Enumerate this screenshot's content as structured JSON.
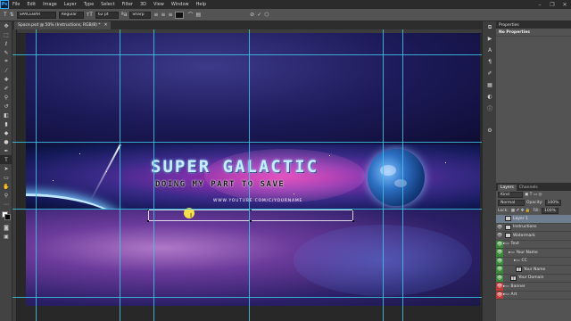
{
  "app": {
    "logo": "Ps"
  },
  "menu": [
    "File",
    "Edit",
    "Image",
    "Layer",
    "Type",
    "Select",
    "Filter",
    "3D",
    "View",
    "Window",
    "Help"
  ],
  "window_controls": {
    "minimize": "–",
    "restore": "❐",
    "close": "✕"
  },
  "options": {
    "font_family": "SPACEBAR",
    "font_style": "Regular",
    "font_size": "62 pt",
    "antialias": "Sharp"
  },
  "document": {
    "tab_title": "Space.psd @ 50% (Instructions, RGB/8) *"
  },
  "banner": {
    "title": "SUPER GALACTIC",
    "subtitle": "DOING MY PART TO SAVE",
    "url": "WWW.YOUTUBE.COM/C/YOURNAME"
  },
  "panels": {
    "properties_tab": "Properties",
    "properties_title": "No Properties",
    "layers_tab": "Layers",
    "channels_tab": "Channels",
    "kind": "Kind",
    "blend_mode": "Normal",
    "opacity_label": "Opacity:",
    "opacity_value": "100%",
    "lock_label": "Lock:",
    "fill_label": "Fill:",
    "fill_value": "100%"
  },
  "layers": [
    {
      "name": "Layer 1",
      "indent": 0,
      "eye": "none",
      "selected": true,
      "kind": "pixel"
    },
    {
      "name": "Instructions",
      "indent": 0,
      "eye": "plain",
      "selected": false,
      "kind": "pixel"
    },
    {
      "name": "Watermark",
      "indent": 0,
      "eye": "plain",
      "selected": false,
      "kind": "pixel"
    },
    {
      "name": "Text",
      "indent": 0,
      "eye": "green",
      "selected": false,
      "kind": "group"
    },
    {
      "name": "Your Name",
      "indent": 1,
      "eye": "green",
      "selected": false,
      "kind": "group"
    },
    {
      "name": "CC",
      "indent": 2,
      "eye": "green",
      "selected": false,
      "kind": "group"
    },
    {
      "name": "Your Name",
      "indent": 2,
      "eye": "green",
      "selected": false,
      "kind": "text"
    },
    {
      "name": "Your Domain",
      "indent": 1,
      "eye": "green",
      "selected": false,
      "kind": "text"
    },
    {
      "name": "Banner",
      "indent": 0,
      "eye": "red",
      "selected": false,
      "kind": "group"
    },
    {
      "name": "Art",
      "indent": 0,
      "eye": "red",
      "selected": false,
      "kind": "group"
    }
  ]
}
